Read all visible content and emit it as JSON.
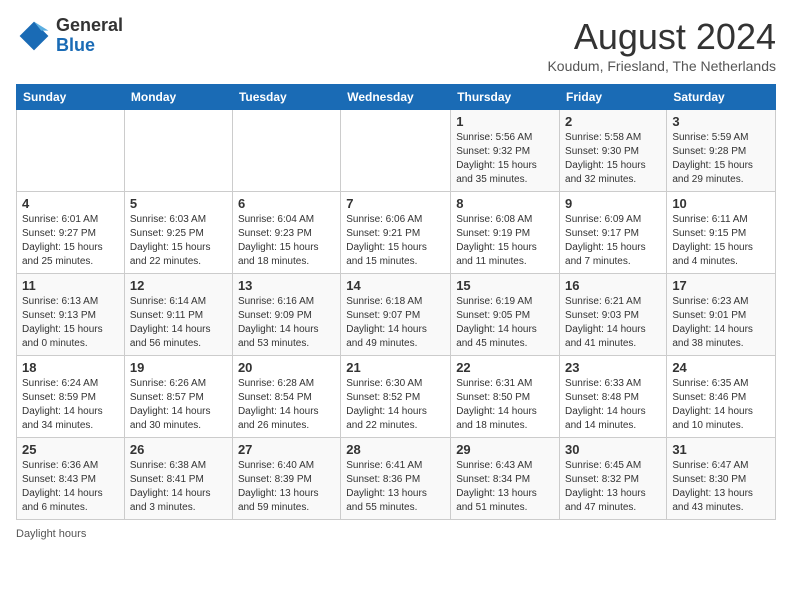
{
  "header": {
    "logo_general": "General",
    "logo_blue": "Blue",
    "title": "August 2024",
    "subtitle": "Koudum, Friesland, The Netherlands"
  },
  "days_of_week": [
    "Sunday",
    "Monday",
    "Tuesday",
    "Wednesday",
    "Thursday",
    "Friday",
    "Saturday"
  ],
  "weeks": [
    [
      {
        "num": "",
        "info": ""
      },
      {
        "num": "",
        "info": ""
      },
      {
        "num": "",
        "info": ""
      },
      {
        "num": "",
        "info": ""
      },
      {
        "num": "1",
        "info": "Sunrise: 5:56 AM\nSunset: 9:32 PM\nDaylight: 15 hours and 35 minutes."
      },
      {
        "num": "2",
        "info": "Sunrise: 5:58 AM\nSunset: 9:30 PM\nDaylight: 15 hours and 32 minutes."
      },
      {
        "num": "3",
        "info": "Sunrise: 5:59 AM\nSunset: 9:28 PM\nDaylight: 15 hours and 29 minutes."
      }
    ],
    [
      {
        "num": "4",
        "info": "Sunrise: 6:01 AM\nSunset: 9:27 PM\nDaylight: 15 hours and 25 minutes."
      },
      {
        "num": "5",
        "info": "Sunrise: 6:03 AM\nSunset: 9:25 PM\nDaylight: 15 hours and 22 minutes."
      },
      {
        "num": "6",
        "info": "Sunrise: 6:04 AM\nSunset: 9:23 PM\nDaylight: 15 hours and 18 minutes."
      },
      {
        "num": "7",
        "info": "Sunrise: 6:06 AM\nSunset: 9:21 PM\nDaylight: 15 hours and 15 minutes."
      },
      {
        "num": "8",
        "info": "Sunrise: 6:08 AM\nSunset: 9:19 PM\nDaylight: 15 hours and 11 minutes."
      },
      {
        "num": "9",
        "info": "Sunrise: 6:09 AM\nSunset: 9:17 PM\nDaylight: 15 hours and 7 minutes."
      },
      {
        "num": "10",
        "info": "Sunrise: 6:11 AM\nSunset: 9:15 PM\nDaylight: 15 hours and 4 minutes."
      }
    ],
    [
      {
        "num": "11",
        "info": "Sunrise: 6:13 AM\nSunset: 9:13 PM\nDaylight: 15 hours and 0 minutes."
      },
      {
        "num": "12",
        "info": "Sunrise: 6:14 AM\nSunset: 9:11 PM\nDaylight: 14 hours and 56 minutes."
      },
      {
        "num": "13",
        "info": "Sunrise: 6:16 AM\nSunset: 9:09 PM\nDaylight: 14 hours and 53 minutes."
      },
      {
        "num": "14",
        "info": "Sunrise: 6:18 AM\nSunset: 9:07 PM\nDaylight: 14 hours and 49 minutes."
      },
      {
        "num": "15",
        "info": "Sunrise: 6:19 AM\nSunset: 9:05 PM\nDaylight: 14 hours and 45 minutes."
      },
      {
        "num": "16",
        "info": "Sunrise: 6:21 AM\nSunset: 9:03 PM\nDaylight: 14 hours and 41 minutes."
      },
      {
        "num": "17",
        "info": "Sunrise: 6:23 AM\nSunset: 9:01 PM\nDaylight: 14 hours and 38 minutes."
      }
    ],
    [
      {
        "num": "18",
        "info": "Sunrise: 6:24 AM\nSunset: 8:59 PM\nDaylight: 14 hours and 34 minutes."
      },
      {
        "num": "19",
        "info": "Sunrise: 6:26 AM\nSunset: 8:57 PM\nDaylight: 14 hours and 30 minutes."
      },
      {
        "num": "20",
        "info": "Sunrise: 6:28 AM\nSunset: 8:54 PM\nDaylight: 14 hours and 26 minutes."
      },
      {
        "num": "21",
        "info": "Sunrise: 6:30 AM\nSunset: 8:52 PM\nDaylight: 14 hours and 22 minutes."
      },
      {
        "num": "22",
        "info": "Sunrise: 6:31 AM\nSunset: 8:50 PM\nDaylight: 14 hours and 18 minutes."
      },
      {
        "num": "23",
        "info": "Sunrise: 6:33 AM\nSunset: 8:48 PM\nDaylight: 14 hours and 14 minutes."
      },
      {
        "num": "24",
        "info": "Sunrise: 6:35 AM\nSunset: 8:46 PM\nDaylight: 14 hours and 10 minutes."
      }
    ],
    [
      {
        "num": "25",
        "info": "Sunrise: 6:36 AM\nSunset: 8:43 PM\nDaylight: 14 hours and 6 minutes."
      },
      {
        "num": "26",
        "info": "Sunrise: 6:38 AM\nSunset: 8:41 PM\nDaylight: 14 hours and 3 minutes."
      },
      {
        "num": "27",
        "info": "Sunrise: 6:40 AM\nSunset: 8:39 PM\nDaylight: 13 hours and 59 minutes."
      },
      {
        "num": "28",
        "info": "Sunrise: 6:41 AM\nSunset: 8:36 PM\nDaylight: 13 hours and 55 minutes."
      },
      {
        "num": "29",
        "info": "Sunrise: 6:43 AM\nSunset: 8:34 PM\nDaylight: 13 hours and 51 minutes."
      },
      {
        "num": "30",
        "info": "Sunrise: 6:45 AM\nSunset: 8:32 PM\nDaylight: 13 hours and 47 minutes."
      },
      {
        "num": "31",
        "info": "Sunrise: 6:47 AM\nSunset: 8:30 PM\nDaylight: 13 hours and 43 minutes."
      }
    ]
  ],
  "footer": {
    "daylight_label": "Daylight hours"
  }
}
